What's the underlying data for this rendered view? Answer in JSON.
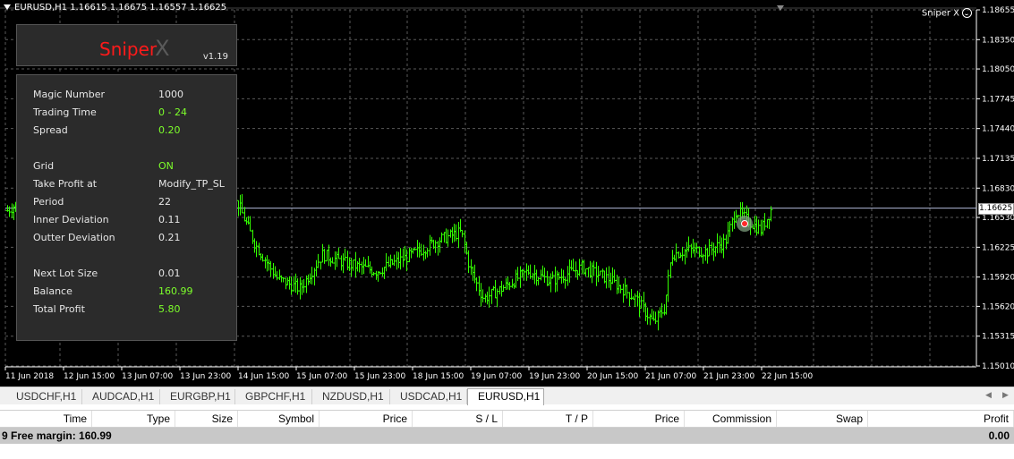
{
  "chart": {
    "title": "EURUSD,H1  1.16615 1.16675 1.16557 1.16625",
    "ea_name": "Sniper X",
    "current_price": "1.16625",
    "price_labels": [
      "1.18655",
      "1.18350",
      "1.18050",
      "1.17745",
      "1.17440",
      "1.17135",
      "1.16830",
      "1.16530",
      "1.16225",
      "1.15920",
      "1.15620",
      "1.15315",
      "1.15010"
    ],
    "time_labels": [
      "11 Jun 2018",
      "12 Jun 15:00",
      "13 Jun 07:00",
      "13 Jun 23:00",
      "14 Jun 15:00",
      "15 Jun 07:00",
      "15 Jun 23:00",
      "18 Jun 15:00",
      "19 Jun 07:00",
      "19 Jun 23:00",
      "20 Jun 15:00",
      "21 Jun 07:00",
      "21 Jun 23:00",
      "22 Jun 15:00"
    ],
    "colors": {
      "background": "#000000",
      "grid": "#5a5a5a",
      "candles": "#33ff00",
      "price_line": "#b0b8d8"
    }
  },
  "panel": {
    "logo_main": "Sniper",
    "logo_suffix": "X",
    "version": "v1.19",
    "rows": [
      {
        "label": "Magic Number",
        "value": "1000",
        "highlight": false
      },
      {
        "label": "Trading Time",
        "value": "0 - 24",
        "highlight": true
      },
      {
        "label": "Spread",
        "value": "0.20",
        "highlight": true
      },
      {
        "label": "Grid",
        "value": "ON",
        "highlight": true
      },
      {
        "label": "Take Profit at",
        "value": "Modify_TP_SL",
        "highlight": false
      },
      {
        "label": "Period",
        "value": "22",
        "highlight": false
      },
      {
        "label": "Inner Deviation",
        "value": "0.11",
        "highlight": false
      },
      {
        "label": "Outter Deviation",
        "value": "0.21",
        "highlight": false
      },
      {
        "label": "Next Lot Size",
        "value": "0.01",
        "highlight": false
      },
      {
        "label": "Balance",
        "value": "160.99",
        "highlight": true
      },
      {
        "label": "Total Profit",
        "value": "5.80",
        "highlight": true
      }
    ]
  },
  "tabs": [
    "USDCHF,H1",
    "AUDCAD,H1",
    "EURGBP,H1",
    "GBPCHF,H1",
    "NZDUSD,H1",
    "USDCAD,H1",
    "EURUSD,H1"
  ],
  "active_tab": "EURUSD,H1",
  "terminal": {
    "columns": [
      "Time",
      "Type",
      "Size",
      "Symbol",
      "Price",
      "S / L",
      "T / P",
      "Price",
      "Commission",
      "Swap",
      "Profit"
    ],
    "free_margin": "9  Free margin: 160.99",
    "profit_total": "0.00"
  }
}
